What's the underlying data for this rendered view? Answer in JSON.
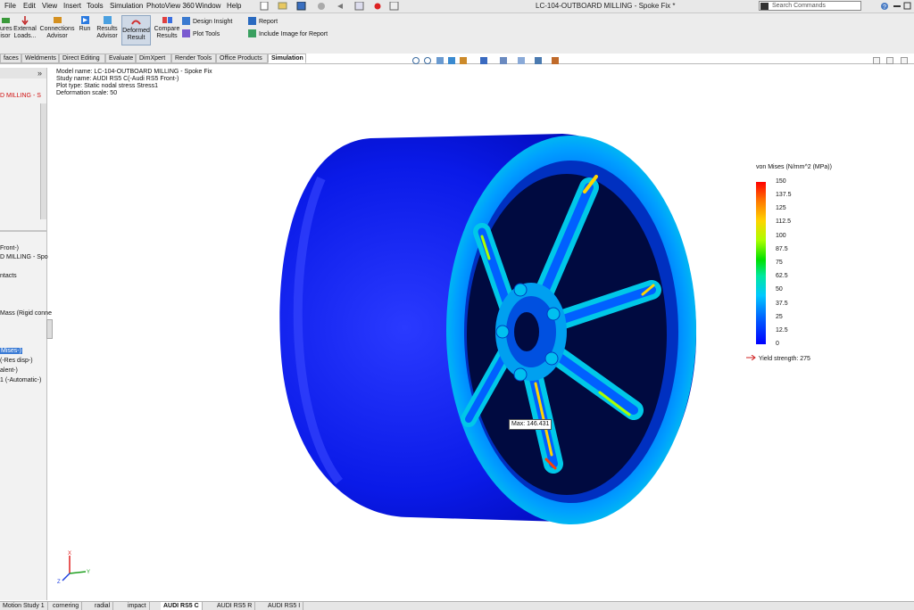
{
  "menu": [
    "File",
    "Edit",
    "View",
    "Insert",
    "Tools",
    "Simulation",
    "PhotoView 360",
    "Window",
    "Help"
  ],
  "window_title": "LC-104-OUTBOARD MILLING - Spoke Fix *",
  "search": {
    "placeholder": "Search Commands"
  },
  "ribbon": {
    "fixtures": "ures\nisor",
    "external": "External\nLoads...",
    "connections": "Connections\nAdvisor",
    "run": "Run",
    "results_advisor": "Results\nAdvisor",
    "deformed": "Deformed\nResult",
    "compare": "Compare\nResults",
    "design_insight": "Design Insight",
    "plot_tools": "Plot Tools",
    "report": "Report",
    "include_image": "Include Image for Report"
  },
  "tabs": [
    "faces",
    "Weldments",
    "Direct Editing",
    "Evaluate",
    "DimXpert",
    "Render Tools",
    "Office Products",
    "Simulation"
  ],
  "sidebar": {
    "title": "D MILLING - S",
    "front": "Front-)",
    "milling": "D MILLING - Spo",
    "contacts": "ntacts",
    "mass": "Mass (Rigid conne",
    "mises": "Mises-)",
    "res_disp": "(-Res disp-)",
    "valent": "alent-)",
    "automatic": "1 (-Automatic-)"
  },
  "info": {
    "model": "Model name: LC-104-OUTBOARD MILLING - Spoke Fix",
    "study": "Study name: AUDI RS5 C(-Audi RS5 Front-)",
    "plot_type": "Plot type: Static nodal stress Stress1",
    "deformation": "Deformation scale: 50"
  },
  "legend": {
    "title": "von Mises (N/mm^2 (MPa))",
    "labels": [
      "150",
      "137.5",
      "125",
      "112.5",
      "100",
      "87.5",
      "75",
      "62.5",
      "50",
      "37.5",
      "25",
      "12.5",
      "0"
    ],
    "yield": "Yield strength: 275"
  },
  "max_label": "Max: 146.431",
  "triad": {
    "x": "X",
    "y": "Y",
    "z": "Z"
  },
  "bottom_tabs": [
    "Motion Study 1",
    "cornering",
    "radial",
    "impact",
    "AUDI RS5 C",
    "AUDI RS5 R",
    "AUDI RS5 I"
  ],
  "colors": {
    "accent": "#3a7bd5",
    "low_stress": "#0000ff",
    "high_stress": "#ff0000"
  }
}
